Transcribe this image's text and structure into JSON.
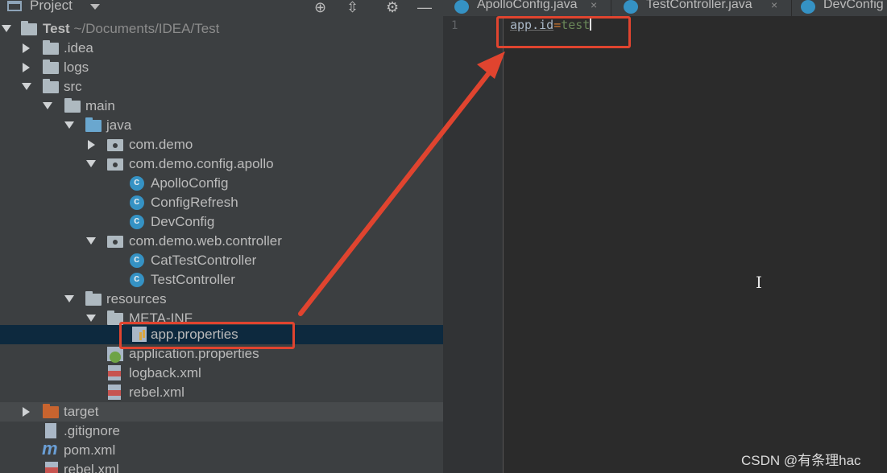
{
  "panel": {
    "title": "Project"
  },
  "tabs": [
    {
      "label": "ApolloConfig.java",
      "close": "×"
    },
    {
      "label": "TestController.java",
      "close": "×"
    },
    {
      "label": "DevConfig"
    }
  ],
  "tree": {
    "root": {
      "name": "Test",
      "path": "~/Documents/IDEA/Test"
    },
    "idea": ".idea",
    "logs": "logs",
    "src": "src",
    "main": "main",
    "java": "java",
    "pkg_demo": "com.demo",
    "pkg_apollo": "com.demo.config.apollo",
    "apollo_config": "ApolloConfig",
    "config_refresh": "ConfigRefresh",
    "dev_config": "DevConfig",
    "pkg_web": "com.demo.web.controller",
    "cat_test": "CatTestController",
    "test_controller": "TestController",
    "resources": "resources",
    "meta_inf": "META-INF",
    "app_props": "app.properties",
    "application_props": "application.properties",
    "logback": "logback.xml",
    "rebel1": "rebel.xml",
    "target": "target",
    "gitignore": ".gitignore",
    "pom": "pom.xml",
    "rebel2": "rebel.xml"
  },
  "editor": {
    "line_number": "1",
    "key": "app.id",
    "eq": "=",
    "value": "test"
  },
  "watermark": "CSDN @有条理hac",
  "colors": {
    "highlight": "#e0442f",
    "selection": "#0d293e"
  },
  "icons": [
    "project-icon",
    "target-icon",
    "collapse-icon",
    "gear-icon",
    "hide-icon",
    "folder-icon",
    "package-icon",
    "java-class-icon",
    "properties-file-icon",
    "spring-properties-icon",
    "xml-file-icon",
    "maven-icon",
    "text-cursor-icon"
  ]
}
